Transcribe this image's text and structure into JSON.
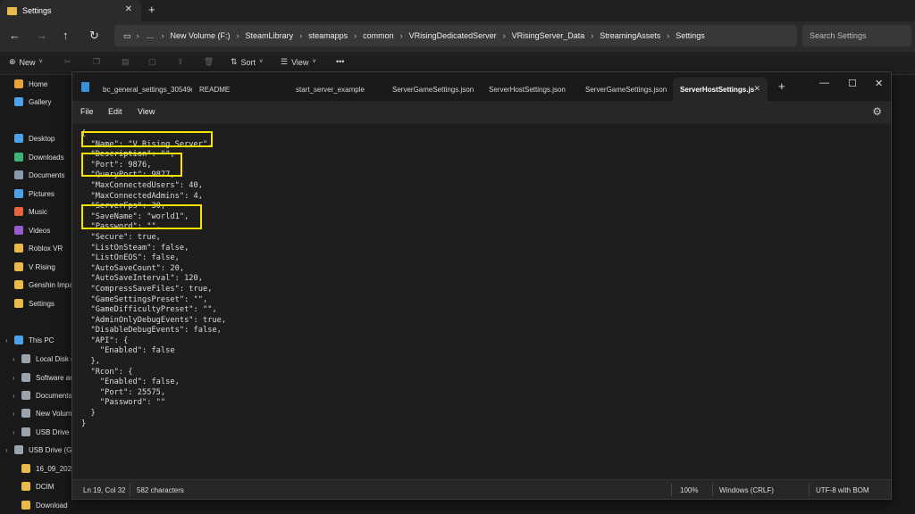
{
  "explorer": {
    "tab_title": "Settings",
    "address": [
      "New Volume (F:)",
      "SteamLibrary",
      "steamapps",
      "common",
      "VRisingDedicatedServer",
      "VRisingServer_Data",
      "StreamingAssets",
      "Settings"
    ],
    "search_placeholder": "Search Settings",
    "toolbar": {
      "new": "New",
      "sort": "Sort",
      "view": "View",
      "more": "•••"
    },
    "sidebar": [
      {
        "label": "Home",
        "icon": "home-icon",
        "color": "#e8a33d"
      },
      {
        "label": "Gallery",
        "icon": "gallery-icon",
        "color": "#4ea3e8"
      },
      {
        "label": "Desktop",
        "icon": "desktop-icon",
        "color": "#4ea3e8"
      },
      {
        "label": "Downloads",
        "icon": "download-icon",
        "color": "#3fb47a"
      },
      {
        "label": "Documents",
        "icon": "documents-icon",
        "color": "#8a9bb0"
      },
      {
        "label": "Pictures",
        "icon": "pictures-icon",
        "color": "#4ea3e8"
      },
      {
        "label": "Music",
        "icon": "music-icon",
        "color": "#e8643d"
      },
      {
        "label": "Videos",
        "icon": "videos-icon",
        "color": "#9b59d0"
      },
      {
        "label": "Roblox VR",
        "icon": "folder-icon",
        "color": "#e9b949"
      },
      {
        "label": "V Rising",
        "icon": "folder-icon",
        "color": "#e9b949"
      },
      {
        "label": "Genshin Impa",
        "icon": "folder-icon",
        "color": "#e9b949"
      },
      {
        "label": "Settings",
        "icon": "folder-icon",
        "color": "#e9b949"
      },
      {
        "label": "This PC",
        "icon": "pc-icon",
        "color": "#4ea3e8"
      },
      {
        "label": "Local Disk (C",
        "icon": "disk-icon",
        "color": "#9aa4ae"
      },
      {
        "label": "Software and",
        "icon": "disk-icon",
        "color": "#9aa4ae"
      },
      {
        "label": "Documents",
        "icon": "disk-icon",
        "color": "#9aa4ae"
      },
      {
        "label": "New Volume",
        "icon": "disk-icon",
        "color": "#9aa4ae"
      },
      {
        "label": "USB Drive (G:",
        "icon": "usb-icon",
        "color": "#9aa4ae"
      },
      {
        "label": "USB Drive (G:)",
        "icon": "usb-icon",
        "color": "#9aa4ae"
      },
      {
        "label": "16_09_2023",
        "icon": "folder-icon",
        "color": "#e9b949"
      },
      {
        "label": "DCIM",
        "icon": "folder-icon",
        "color": "#e9b949"
      },
      {
        "label": "Download",
        "icon": "folder-icon",
        "color": "#e9b949"
      }
    ]
  },
  "editor": {
    "tabs": [
      "bc_general_settings_30549e4...",
      "README",
      "start_server_example",
      "ServerGameSettings.json",
      "ServerHostSettings.json",
      "ServerGameSettings.json",
      "ServerHostSettings.js"
    ],
    "menu": [
      "File",
      "Edit",
      "View"
    ],
    "code_lines": [
      "{",
      "  \"Name\": \"V Rising Server\",",
      "  \"Description\": \"\",",
      "  \"Port\": 9876,",
      "  \"QueryPort\": 9877,",
      "  \"MaxConnectedUsers\": 40,",
      "  \"MaxConnectedAdmins\": 4,",
      "  \"ServerFps\": 30,",
      "  \"SaveName\": \"world1\",",
      "  \"Password\": \"\",",
      "  \"Secure\": true,",
      "  \"ListOnSteam\": false,",
      "  \"ListOnEOS\": false,",
      "  \"AutoSaveCount\": 20,",
      "  \"AutoSaveInterval\": 120,",
      "  \"CompressSaveFiles\": true,",
      "  \"GameSettingsPreset\": \"\",",
      "  \"GameDifficultyPreset\": \"\",",
      "  \"AdminOnlyDebugEvents\": true,",
      "  \"DisableDebugEvents\": false,",
      "  \"API\": {",
      "    \"Enabled\": false",
      "  },",
      "  \"Rcon\": {",
      "    \"Enabled\": false,",
      "    \"Port\": 25575,",
      "    \"Password\": \"\"",
      "  }",
      "}"
    ],
    "status": {
      "position": "Ln 19, Col 32",
      "chars": "582 characters",
      "zoom": "100%",
      "line_ending": "Windows (CRLF)",
      "encoding": "UTF-8 with BOM"
    },
    "highlight_color": "#f5e400"
  }
}
